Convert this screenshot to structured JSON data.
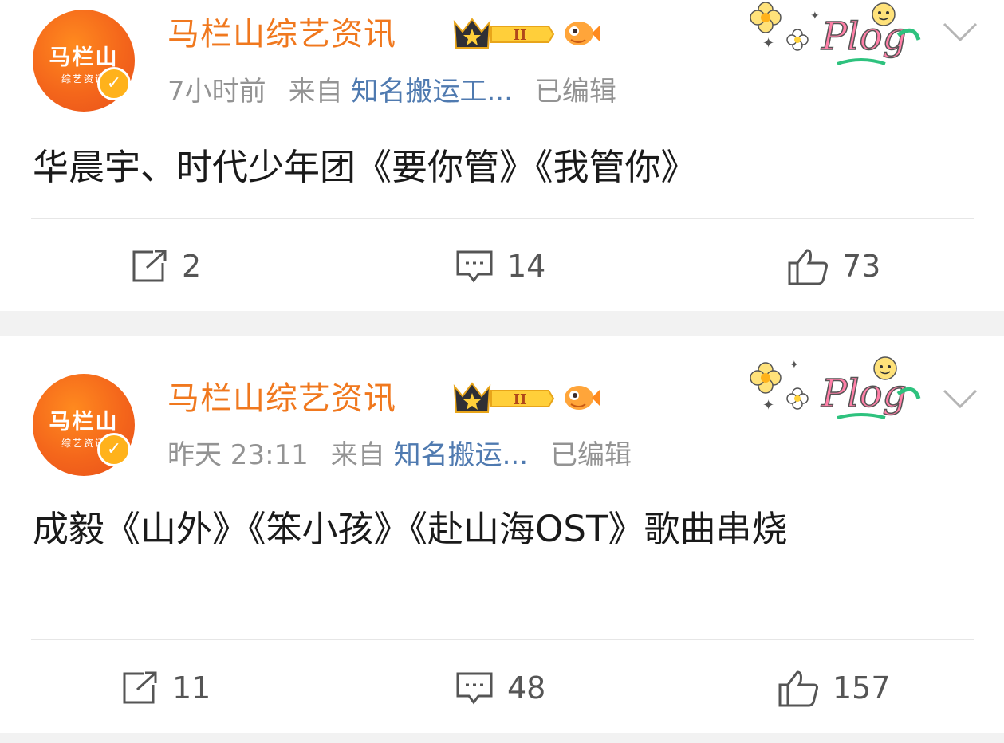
{
  "posts": [
    {
      "author": "马栏山综艺资讯",
      "avatar_text": "马栏山",
      "avatar_subtext": "综艺资讯",
      "level_badge": "II",
      "time": "7小时前",
      "from_label": "来自",
      "source": "知名搬运工...",
      "edited": "已编辑",
      "sticker": "Plog",
      "content": "华晨宇、时代少年团《要你管》《我管你》",
      "reposts": "2",
      "comments": "14",
      "likes": "73"
    },
    {
      "author": "马栏山综艺资讯",
      "avatar_text": "马栏山",
      "avatar_subtext": "综艺资讯",
      "level_badge": "II",
      "time": "昨天 23:11",
      "from_label": "来自",
      "source": "知名搬运...",
      "edited": "已编辑",
      "sticker": "Plog",
      "content": "成毅《山外》《笨小孩》《赴山海OST》歌曲串烧",
      "reposts": "11",
      "comments": "48",
      "likes": "157"
    }
  ],
  "colors": {
    "author": "#f0781e",
    "source_link": "#4f7ab0",
    "meta": "#939393",
    "avatar": "#f4661b",
    "verified": "#ffb21b"
  }
}
